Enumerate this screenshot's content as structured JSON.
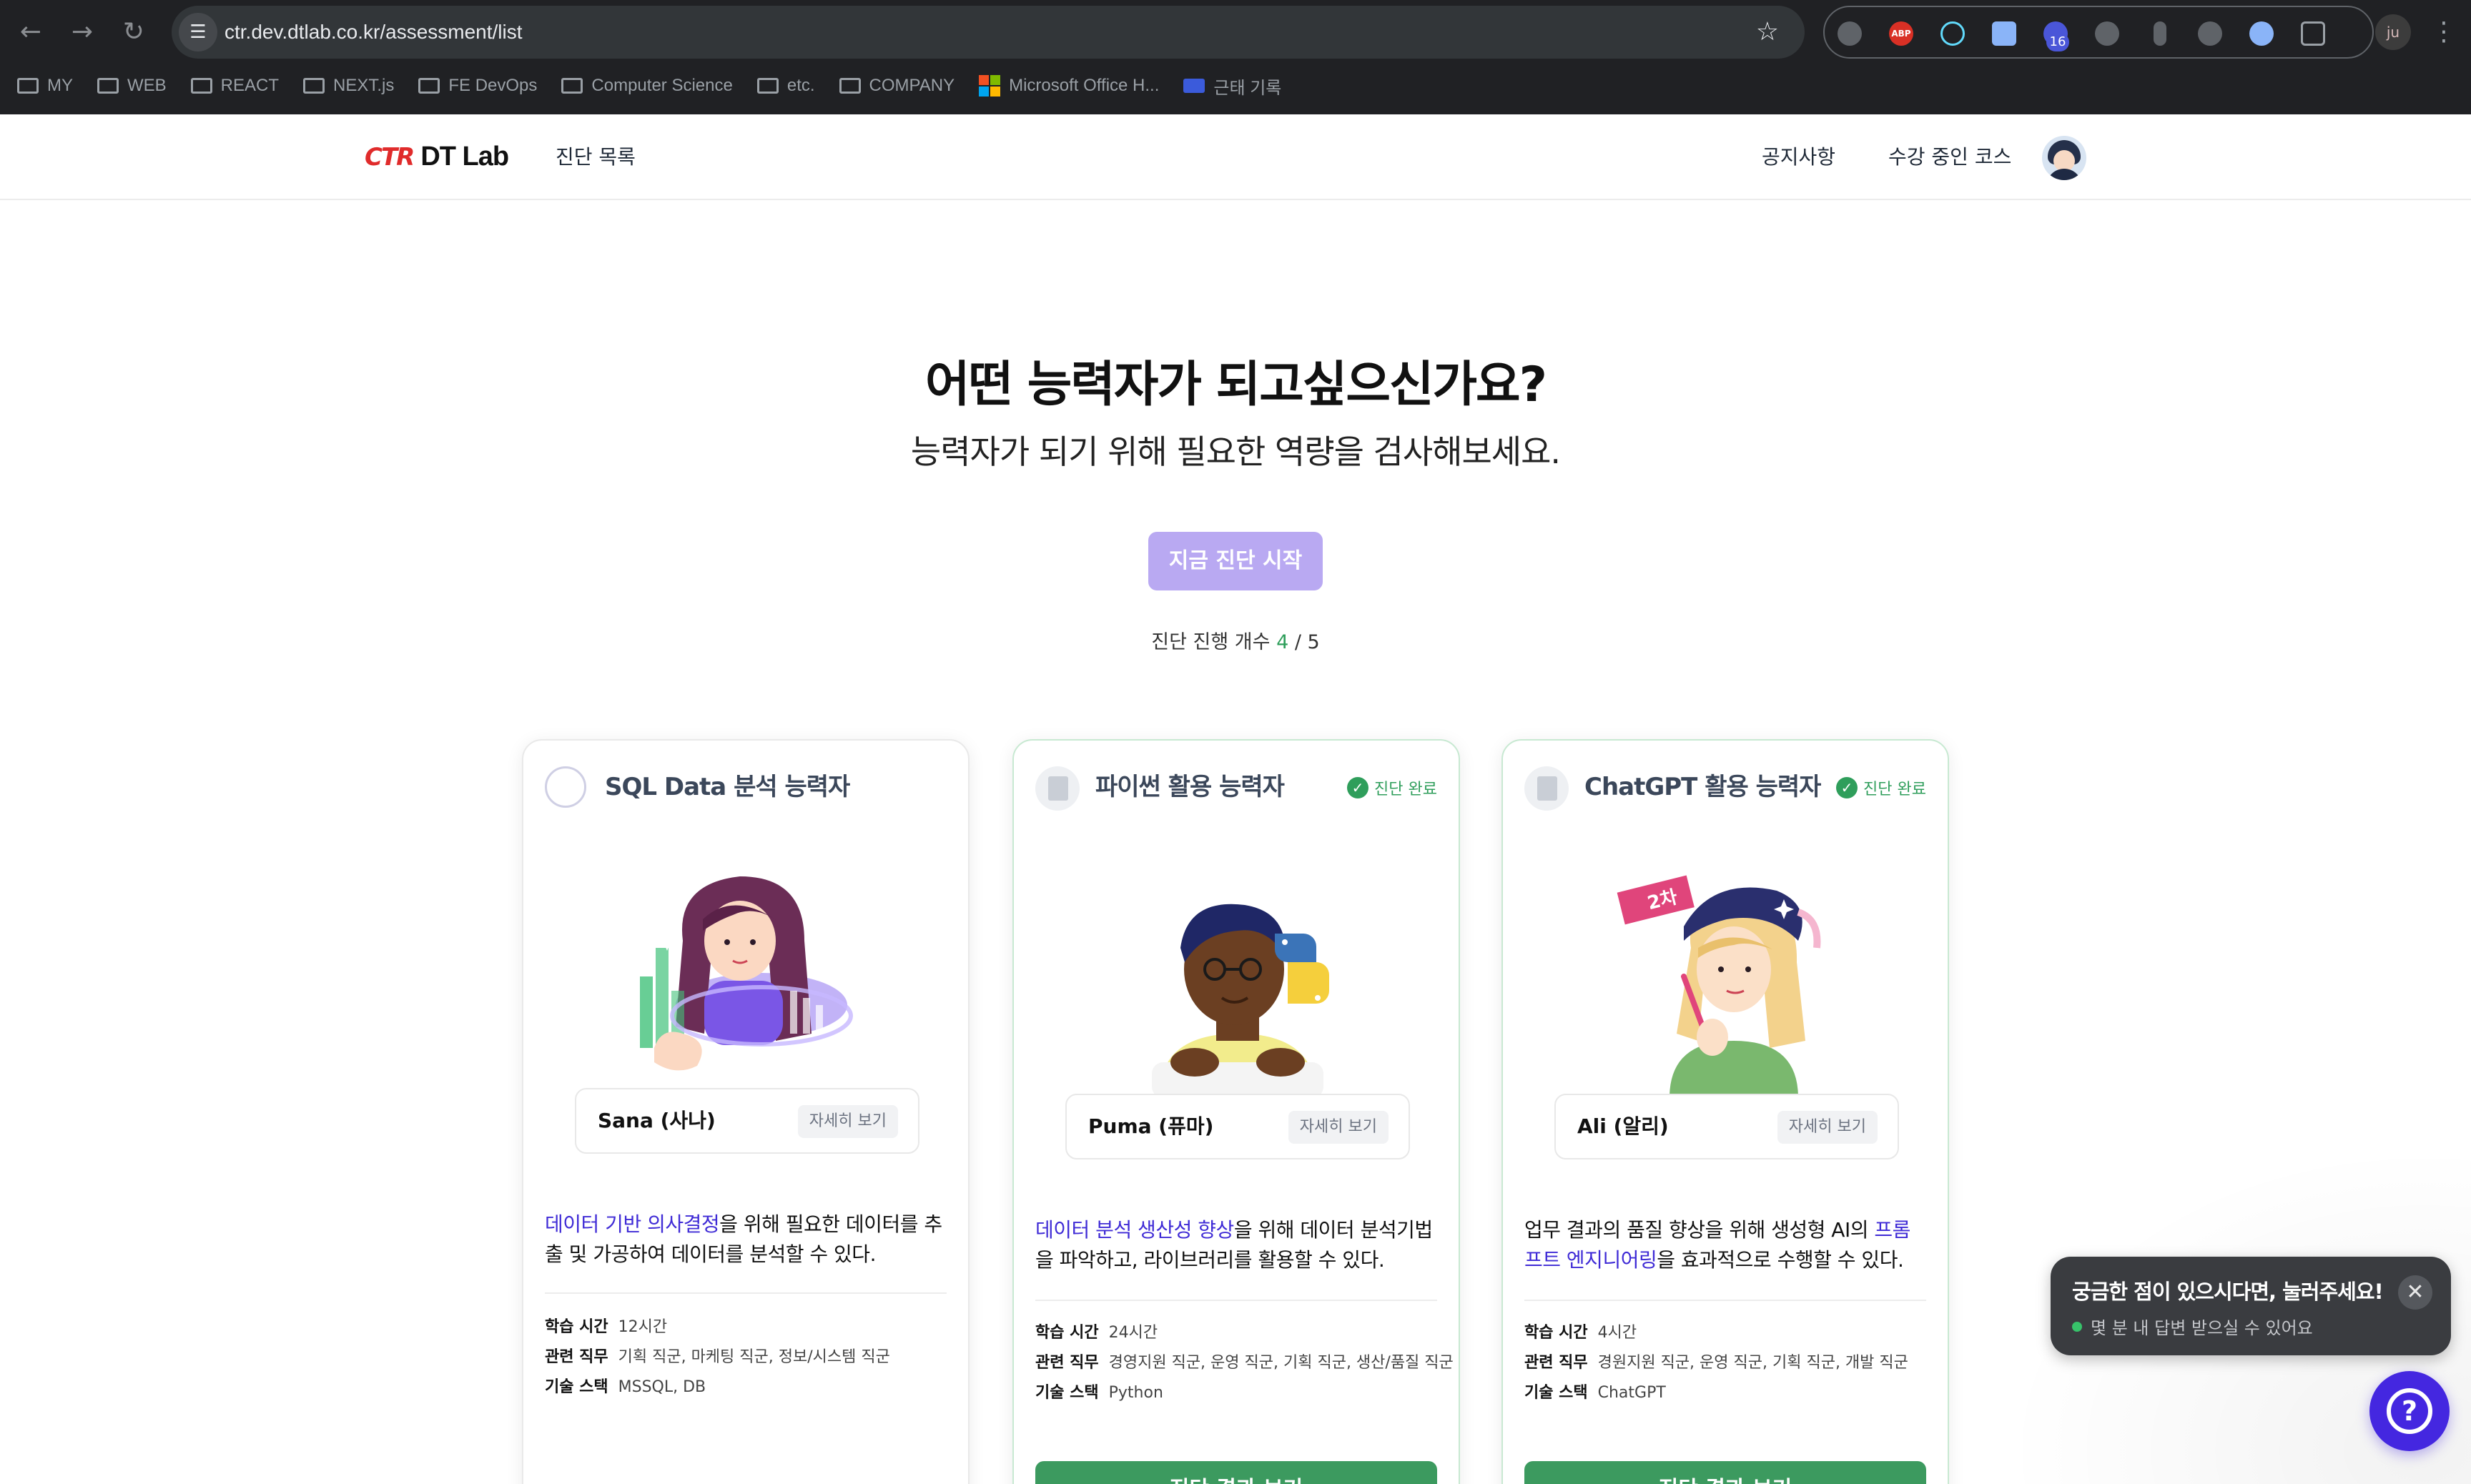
{
  "browser": {
    "url": "ctr.dev.dtlab.co.kr/assessment/list",
    "profile_initials": "ju",
    "extension_badge": "16",
    "bookmarks": [
      {
        "label": "MY",
        "type": "folder"
      },
      {
        "label": "WEB",
        "type": "folder"
      },
      {
        "label": "REACT",
        "type": "folder"
      },
      {
        "label": "NEXT.js",
        "type": "folder"
      },
      {
        "label": "FE DevOps",
        "type": "folder"
      },
      {
        "label": "Computer Science",
        "type": "folder"
      },
      {
        "label": "etc.",
        "type": "folder"
      },
      {
        "label": "COMPANY",
        "type": "folder"
      },
      {
        "label": "Microsoft Office H...",
        "type": "ms"
      },
      {
        "label": "근태 기록",
        "type": "link"
      }
    ]
  },
  "header": {
    "logo_ctr": "CTR",
    "logo_dt": "DT Lab",
    "nav_assessments": "진단 목록",
    "nav_notice": "공지사항",
    "nav_courses": "수강 중인 코스"
  },
  "hero": {
    "title": "어떤 능력자가 되고싶으신가요?",
    "subtitle": "능력자가 되기 위해 필요한 역량을 검사해보세요.",
    "start_button": "지금 진단 시작",
    "progress_label": "진단 진행 개수",
    "progress_done": "4",
    "progress_sep": " / ",
    "progress_total": "5"
  },
  "cards": [
    {
      "title": "SQL Data 분석 능력자",
      "completed": false,
      "mentor": "Sana (사나)",
      "detail_button": "자세히 보기",
      "desc_highlight": "데이터 기반 의사결정",
      "desc_text": "을 위해 필요한 데이터를 추출 및 가공하여 데이터를 분석할 수 있다.",
      "study_time_label": "학습 시간",
      "study_time": "12시간",
      "jobs_label": "관련 직무",
      "jobs": "기획 직군, 마케팅 직군, 정보/시스템 직군",
      "stack_label": "기술 스택",
      "stack": "MSSQL, DB"
    },
    {
      "title": "파이썬 활용 능력자",
      "completed": true,
      "done_label": "진단 완료",
      "mentor": "Puma (퓨마)",
      "detail_button": "자세히 보기",
      "desc_highlight": "데이터 분석 생산성 향상",
      "desc_text": "을 위해 데이터 분석기법을 파악하고, 라이브러리를 활용할 수 있다.",
      "study_time_label": "학습 시간",
      "study_time": "24시간",
      "jobs_label": "관련 직무",
      "jobs": "경영지원 직군, 운영 직군, 기획 직군, 생산/품질 직군",
      "stack_label": "기술 스택",
      "stack": "Python",
      "result_button": "진단 결과 보기"
    },
    {
      "title": "ChatGPT 활용 능력자",
      "completed": true,
      "done_label": "진단 완료",
      "mentor": "Ali (알리)",
      "detail_button": "자세히 보기",
      "desc_prefix": "업무 결과의 품질 향상을 위해 생성형 AI의 ",
      "desc_highlight": "프롬프트 엔지니어링",
      "desc_text": "을 효과적으로 수행할 수 있다.",
      "tag": "2차",
      "study_time_label": "학습 시간",
      "study_time": "4시간",
      "jobs_label": "관련 직무",
      "jobs": "경원지원 직군, 운영 직군, 기획 직군, 개발 직군",
      "stack_label": "기술 스택",
      "stack": "ChatGPT",
      "result_button": "진단 결과 보기"
    }
  ],
  "chat": {
    "title": "궁금한 점이 있으시다면, 눌러주세요!",
    "subtitle": "몇 분 내 답변 받으실 수 있어요",
    "fab_glyph": "?"
  },
  "colors": {
    "accent_purple": "#4427e0",
    "start_button_disabled": "#b9a9f2",
    "success_green": "#2f9e5b",
    "highlight_text": "#3f2bd6"
  }
}
